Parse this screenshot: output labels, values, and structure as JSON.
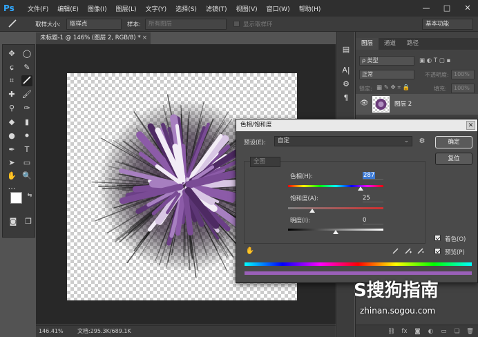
{
  "app": {
    "logo": "Ps"
  },
  "menu": [
    "文件(F)",
    "编辑(E)",
    "图像(I)",
    "图层(L)",
    "文字(Y)",
    "选择(S)",
    "滤镜(T)",
    "视图(V)",
    "窗口(W)",
    "帮助(H)"
  ],
  "window_controls": {
    "minimize": "—",
    "restore": "□",
    "close": "✕"
  },
  "options_bar": {
    "sample_size_label": "取样大小:",
    "sample_size_value": "取样点",
    "sample_label": "样本:",
    "sample_value": "所有图层",
    "show_ring_label": "显示取样环",
    "workspace_value": "基本功能"
  },
  "document_tab": {
    "title": "未标题-1 @ 146% (图层 2, RGB/8) *",
    "close": "×"
  },
  "status_bar": {
    "zoom": "146.41%",
    "doc_info": "文档:295.3K/689.1K"
  },
  "layers_panel": {
    "tabs": [
      "图层",
      "通道",
      "路径"
    ],
    "filter_placeholder": "ρ 类型",
    "blend_mode": "正常",
    "opacity_label": "不透明度:",
    "opacity_value": "100%",
    "lock_label": "锁定:",
    "fill_label": "填充:",
    "fill_value": "100%",
    "layer_name": "图层 2"
  },
  "dialog": {
    "title": "色相/饱和度",
    "preset_label": "预设(E):",
    "preset_value": "自定",
    "channel_value": "全图",
    "hue_label": "色相(H):",
    "hue_value": "287",
    "saturation_label": "饱和度(A):",
    "saturation_value": "25",
    "lightness_label": "明度(I):",
    "lightness_value": "0",
    "ok_label": "确定",
    "reset_label": "复位",
    "colorize_label": "着色(O)",
    "preview_label": "预览(P)",
    "colorize_checked": true,
    "preview_checked": true,
    "hue_pos": 0.76,
    "saturation_pos": 0.25,
    "lightness_pos": 0.5
  },
  "watermark": {
    "logo": "S搜狗指南",
    "url": "zhinan.sogou.com"
  },
  "colors": {
    "accent": "#31a8ff",
    "selection": "#3d7bd6",
    "dialog_bg": "#4a4a4a"
  }
}
